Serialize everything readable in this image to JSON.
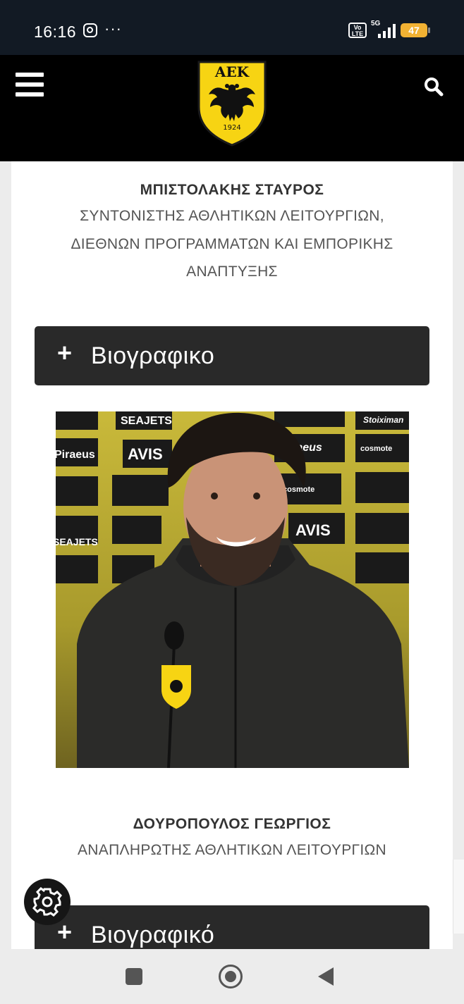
{
  "status_bar": {
    "time": "16:16",
    "icons": [
      "instagram-icon",
      "more-dots-icon",
      "volte-icon",
      "5g-signal-icon",
      "battery-icon"
    ],
    "more": "···",
    "volte_label_top": "Vo",
    "volte_label_bottom": "LTE",
    "network": "5G",
    "battery": "47",
    "battery_color": "#f2b233"
  },
  "header": {
    "logo_text": "ΑΕΚ",
    "logo_year": "1924",
    "logo_color": "#f7d413",
    "menu_icon": "hamburger-icon",
    "search_icon": "search-icon"
  },
  "people": [
    {
      "name": "ΜΠΙΣΤΟΛΑΚΗΣ ΣΤΑΥΡΟΣ",
      "role_lines": [
        "ΣΥΝΤΟΝΙΣΤΗΣ ΑΘΛΗΤΙΚΩΝ ΛΕΙΤΟΥΡΓΙΩΝ,",
        "ΔΙΕΘΝΩΝ ΠΡΟΓΡΑΜΜΑΤΩΝ ΚΑΙ ΕΜΠΟΡΙΚΗΣ",
        "ΑΝΑΠΤΥΞΗΣ"
      ],
      "bio_button": "Βιογραφικο"
    },
    {
      "name": "ΔΟΥΡΟΠΟΥΛΟΣ ΓΕΩΡΓΙΟΣ",
      "role_lines": [
        "ΑΝΑΠΛΗΡΩΤΗΣ ΑΘΛΗΤΙΚΩΝ ΛΕΙΤΟΥΡΓΙΩΝ"
      ],
      "bio_button": "Βιογραφικό"
    }
  ],
  "bio_plus": "+",
  "photo_backdrop_sponsors": [
    "SEAJETS",
    "Piraeus",
    "AVIS",
    "cosmote",
    "Stoiximan",
    "Piraeus",
    "AVIS",
    "SEAJETS",
    "cosmote"
  ],
  "floating": {
    "settings_icon": "gear-icon"
  },
  "nav": {
    "recent_icon": "recent-apps-icon",
    "home_icon": "home-icon",
    "back_icon": "back-icon"
  }
}
